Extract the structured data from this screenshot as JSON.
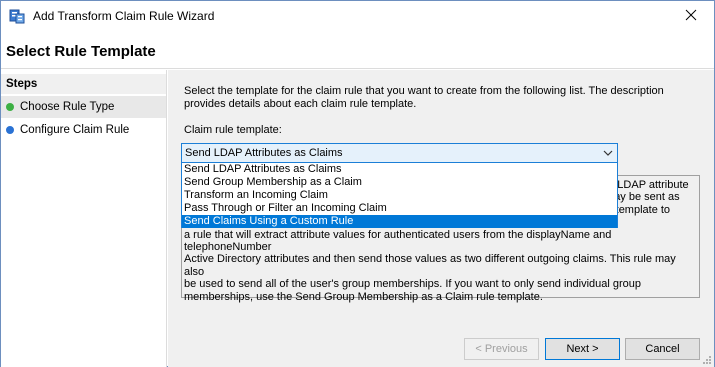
{
  "window": {
    "title": "Add Transform Claim Rule Wizard",
    "icon": "wizard-app-icon",
    "close_icon": "close-icon"
  },
  "header": {
    "page_title": "Select Rule Template"
  },
  "steps": {
    "heading": "Steps",
    "items": [
      {
        "label": "Choose Rule Type",
        "status": "current",
        "color": "#3cb043"
      },
      {
        "label": "Configure Claim Rule",
        "status": "pending",
        "color": "#2a72d4"
      }
    ]
  },
  "main": {
    "instruction": "Select the template for the claim rule that you want to create from the following list. The description provides details about each claim rule template.",
    "template_label": "Claim rule template:",
    "combo_value": "Send LDAP Attributes as Claims",
    "options": [
      "Send LDAP Attributes as Claims",
      "Send Group Membership as a Claim",
      "Transform an Incoming Claim",
      "Pass Through or Filter an Incoming Claim",
      "Send Claims Using a Custom Rule"
    ],
    "highlighted_option": "Send Claims Using a Custom Rule",
    "description_lines": [
      "Using the Send LDAP Attribute as Claims rule template you can select attributes from an LDAP attribute",
      "store such as Active Directory to send as claims to the relying party. Multiple attributes may be sent as",
      "multiple claims from a single rule using this rule type. For example, you can use this rule template to create",
      "a rule that will extract attribute values for authenticated users from the displayName and telephoneNumber",
      "Active Directory attributes and then send those values as two different outgoing claims. This rule may also",
      "be used to send all of the user's group memberships. If you want to only send individual group",
      "memberships, use the Send Group Membership as a Claim rule template."
    ]
  },
  "footer": {
    "previous_label": "< Previous",
    "next_label": "Next >",
    "cancel_label": "Cancel"
  },
  "colors": {
    "accent": "#0078d7",
    "selection": "#0078d7",
    "panel": "#f0f0f0"
  }
}
